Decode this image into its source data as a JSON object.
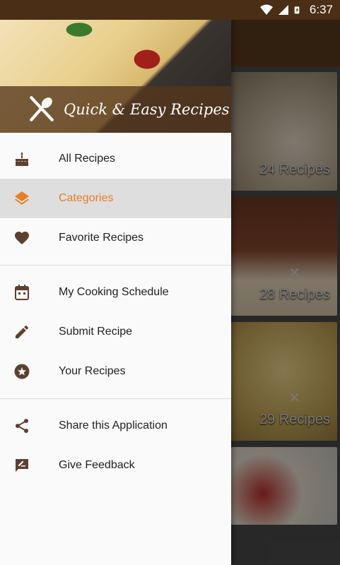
{
  "status_bar": {
    "time": "6:37"
  },
  "header": {
    "title": "Quick & Easy Recipes"
  },
  "menu": {
    "group1": [
      {
        "label": "All Recipes",
        "icon": "cake-icon",
        "active": false
      },
      {
        "label": "Categories",
        "icon": "layers-icon",
        "active": true
      },
      {
        "label": "Favorite Recipes",
        "icon": "heart-icon",
        "active": false
      }
    ],
    "group2": [
      {
        "label": "My Cooking Schedule",
        "icon": "calendar-icon"
      },
      {
        "label": "Submit Recipe",
        "icon": "pencil-icon"
      },
      {
        "label": "Your Recipes",
        "icon": "star-icon"
      }
    ],
    "group3": [
      {
        "label": "Share this Application",
        "icon": "share-icon"
      },
      {
        "label": "Give Feedback",
        "icon": "feedback-icon"
      }
    ]
  },
  "background_cards": [
    {
      "count": "24 Recipes"
    },
    {
      "count": "28 Recipes"
    },
    {
      "count": "29 Recipes"
    }
  ],
  "colors": {
    "accent": "#e67e22",
    "brand_brown": "#5a3a1c",
    "icon_brown": "#5d4030"
  }
}
